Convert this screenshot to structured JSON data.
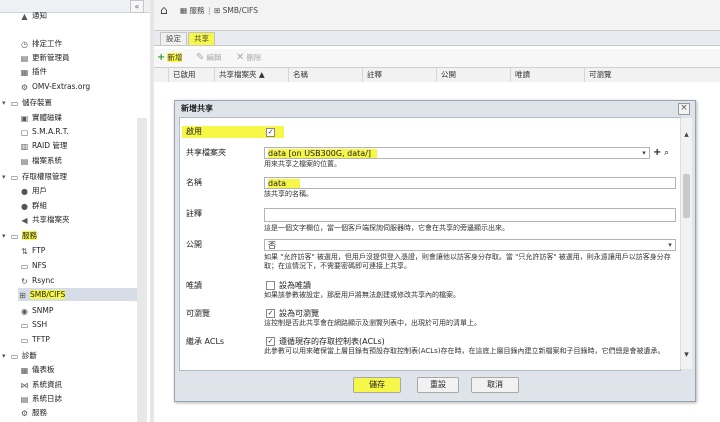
{
  "sidebar": {
    "collapse_symbol": "«",
    "items": [
      {
        "label": "通知",
        "icon": "bell-icon"
      },
      {
        "label": "排定工作",
        "icon": "clock-icon"
      },
      {
        "label": "更新管理員",
        "icon": "update-icon"
      },
      {
        "label": "插件",
        "icon": "plugin-icon"
      },
      {
        "label": "OMV-Extras.org",
        "icon": "gear-icon"
      },
      {
        "label": "儲存裝置",
        "icon": "folder-icon"
      },
      {
        "label": "實體磁碟",
        "icon": "disk-icon"
      },
      {
        "label": "S.M.A.R.T.",
        "icon": "smart-icon"
      },
      {
        "label": "RAID 管理",
        "icon": "raid-icon"
      },
      {
        "label": "檔案系統",
        "icon": "filesystem-icon"
      },
      {
        "label": "存取權限管理",
        "icon": "folder-icon"
      },
      {
        "label": "用戶",
        "icon": "user-icon"
      },
      {
        "label": "群組",
        "icon": "group-icon"
      },
      {
        "label": "共享檔案夾",
        "icon": "share-icon"
      },
      {
        "label": "服務",
        "icon": "folder-icon"
      },
      {
        "label": "FTP",
        "icon": "ftp-icon"
      },
      {
        "label": "NFS",
        "icon": "nfs-icon"
      },
      {
        "label": "Rsync",
        "icon": "rsync-icon"
      },
      {
        "label": "SMB/CIFS",
        "icon": "windows-icon"
      },
      {
        "label": "SNMP",
        "icon": "snmp-icon"
      },
      {
        "label": "SSH",
        "icon": "terminal-icon"
      },
      {
        "label": "TFTP",
        "icon": "tftp-icon"
      },
      {
        "label": "診斷",
        "icon": "folder-icon"
      },
      {
        "label": "儀表板",
        "icon": "dashboard-icon"
      },
      {
        "label": "系統資訊",
        "icon": "info-icon"
      },
      {
        "label": "系統日誌",
        "icon": "log-icon"
      },
      {
        "label": "服務",
        "icon": "service-icon"
      }
    ]
  },
  "breadcrumb": {
    "home_icon": "home-icon",
    "item1": "服務",
    "item2": "SMB/CIFS"
  },
  "tabs": [
    {
      "label": "設定"
    },
    {
      "label": "共享"
    }
  ],
  "toolbar": {
    "add": "新增",
    "edit": "編輯",
    "delete": "刪除"
  },
  "grid": {
    "columns": [
      "已啟用",
      "共享檔案夾 ▲",
      "名稱",
      "註釋",
      "公開",
      "唯讀",
      "可瀏覽"
    ]
  },
  "dialog": {
    "title": "新增共享",
    "close_symbol": "×",
    "fields": {
      "enable": {
        "label": "啟用",
        "checked": "✓"
      },
      "shared_folder": {
        "label": "共享檔案夾",
        "value": "data [on USB300G, data/]",
        "help": "用來共享之檔案的位置。",
        "add_symbol": "+",
        "search_symbol": "⌕"
      },
      "name": {
        "label": "名稱",
        "value": "data",
        "help": "該共享的名稱。"
      },
      "comment": {
        "label": "註釋",
        "value": "",
        "help": "這是一個文字欄位，當一個客戶端探詢伺服器時，它會在共享的旁邊顯示出來。"
      },
      "public": {
        "label": "公開",
        "value": "否",
        "help": "如果 \"允許訪客\" 被選用，但用戶沒提供登入憑證，則會讓他以訪客身分存取。當 \"只允許訪客\" 被選用，則永遠讓用戶以訪客身分存取；在這情況下，不需要密碼即可連接上共享。"
      },
      "readonly": {
        "label": "唯讀",
        "check_label": "設為唯讀",
        "help": "如果該參數被設定，那麼用戶將無法創建或修改共享內的檔案。"
      },
      "browseable": {
        "label": "可瀏覽",
        "check_label": "設為可瀏覽",
        "checked": "✓",
        "help": "這控制是否此共享會在網路顯示及瀏覽列表中，出現於可用的清單上。"
      },
      "acls": {
        "label": "繼承 ACLs",
        "check_label": "遵循現存的存取控制表(ACLs)",
        "checked": "✓",
        "help": "此參數可以用來確保當上層目錄有預設存取控制表(ACLs)存在時，在這底上層目錄內建立新檔案和子目錄時，它們總是會被遺承。"
      }
    },
    "buttons": {
      "save": "儲存",
      "reset": "重設",
      "cancel": "取消"
    }
  },
  "colors": {
    "highlight": "#f7f74a",
    "selected_row": "#d6dde6",
    "add_icon": "#3a9a2e"
  }
}
